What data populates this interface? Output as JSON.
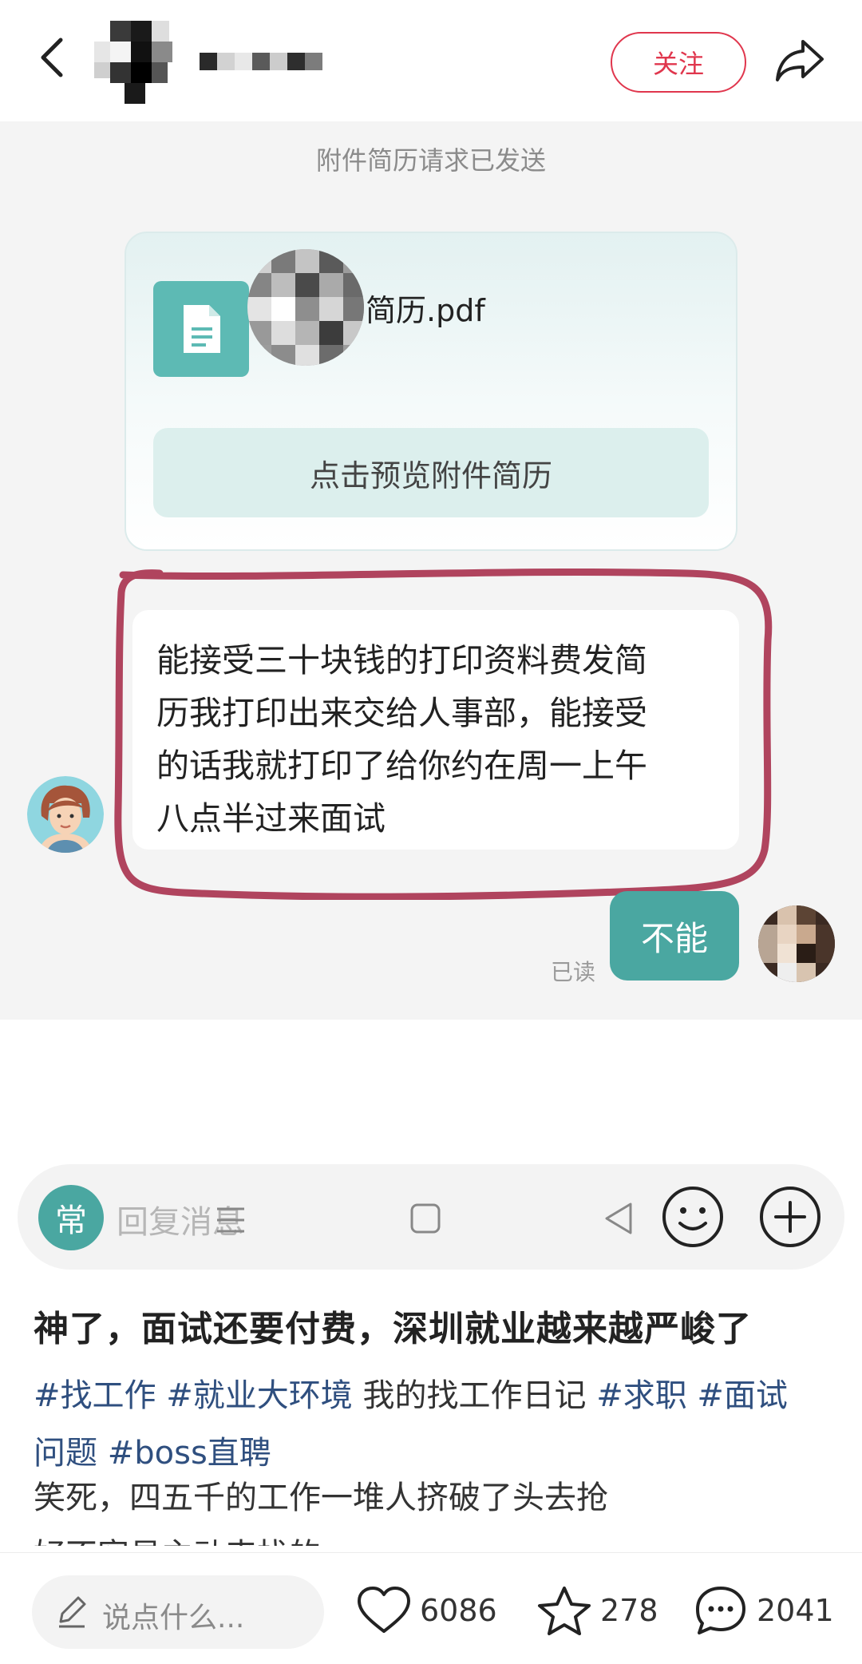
{
  "header": {
    "follow_label": "关注"
  },
  "chat": {
    "system_message": "附件简历请求已发送",
    "file_card": {
      "file_name": "简历.pdf",
      "preview_label": "点击预览附件简历"
    },
    "received_message": {
      "lines": [
        "能接受三十块钱的打印资料费发简",
        "历我打印出来交给人事部，能接受",
        "的话我就打印了给你约在周一上午",
        "八点半过来面试"
      ]
    },
    "sent_message": {
      "text": "不能",
      "read_status": "已读"
    },
    "input": {
      "quick_label": "常",
      "placeholder": "回复消息"
    },
    "colors": {
      "accent": "#4aa7a1",
      "follow": "#e0364d",
      "highlight_circle": "#b0445e"
    }
  },
  "post": {
    "title": "神了，面试还要付费，深圳就业越来越严峻了",
    "tags_line1": [
      "#找工作",
      "#就业大环境"
    ],
    "plain_text": "我的找工作日记",
    "tags_line1_end": [
      "#求职",
      "#面试"
    ],
    "tags_line2": [
      "问题",
      "#boss直聘"
    ],
    "body_lines": [
      "笑死，四五千的工作一堆人挤破了头去抢",
      "好不容易主动来找的"
    ],
    "tag_color": "#2f4f7f"
  },
  "bottom_bar": {
    "comment_placeholder": "说点什么...",
    "likes": "6086",
    "favorites": "278",
    "comments": "2041"
  }
}
